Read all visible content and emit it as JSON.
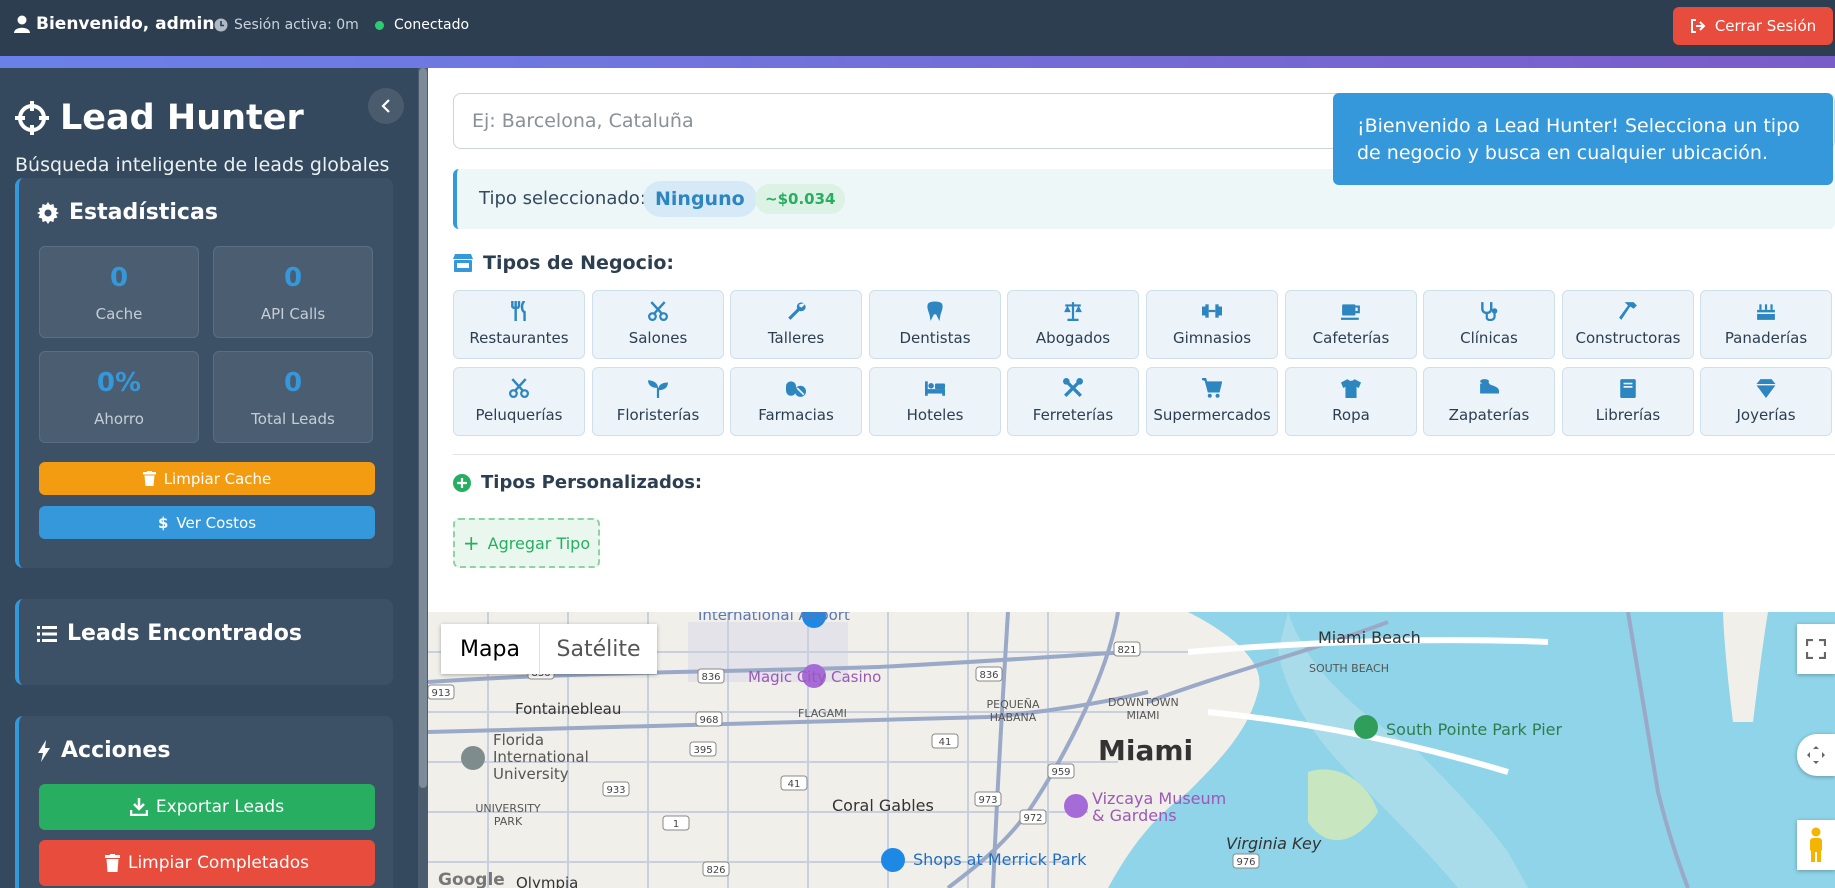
{
  "topbar": {
    "welcome": "Bienvenido, admin",
    "session": "Sesión activa: 0m",
    "status": "Conectado",
    "logout": "Cerrar Sesión"
  },
  "sidebar": {
    "brand": "Lead Hunter",
    "tagline": "Búsqueda inteligente de leads globales",
    "stats": {
      "title": "Estadísticas",
      "cache_value": "0",
      "cache_label": "Cache",
      "api_value": "0",
      "api_label": "API Calls",
      "saving_value": "0%",
      "saving_label": "Ahorro",
      "total_value": "0",
      "total_label": "Total Leads",
      "clear_cache": "Limpiar Cache",
      "view_costs": "Ver Costos"
    },
    "leads": {
      "title": "Leads Encontrados"
    },
    "actions": {
      "title": "Acciones",
      "export": "Exportar Leads",
      "clear_completed": "Limpiar Completados"
    }
  },
  "main": {
    "search_placeholder": "Ej: Barcelona, Cataluña",
    "tooltip": "¡Bienvenido a Lead Hunter! Selecciona un tipo de negocio y busca en cualquier ubicación.",
    "selected_label": "Tipo seleccionado:",
    "selected_value": "Ninguno",
    "selected_cost": "~$0.034",
    "business_title": "Tipos de Negocio:",
    "business_types": [
      {
        "label": "Restaurantes",
        "icon": "utensils-icon"
      },
      {
        "label": "Salones",
        "icon": "scissors-icon"
      },
      {
        "label": "Talleres",
        "icon": "wrench-icon"
      },
      {
        "label": "Dentistas",
        "icon": "tooth-icon"
      },
      {
        "label": "Abogados",
        "icon": "balance-scale-icon"
      },
      {
        "label": "Gimnasios",
        "icon": "dumbbell-icon"
      },
      {
        "label": "Cafeterías",
        "icon": "coffee-icon"
      },
      {
        "label": "Clínicas",
        "icon": "stethoscope-icon"
      },
      {
        "label": "Constructoras",
        "icon": "hammer-icon"
      },
      {
        "label": "Panaderías",
        "icon": "cake-icon"
      },
      {
        "label": "Peluquerías",
        "icon": "scissors-icon"
      },
      {
        "label": "Floristerías",
        "icon": "seedling-icon"
      },
      {
        "label": "Farmacias",
        "icon": "pills-icon"
      },
      {
        "label": "Hoteles",
        "icon": "bed-icon"
      },
      {
        "label": "Ferreterías",
        "icon": "tools-icon"
      },
      {
        "label": "Supermercados",
        "icon": "cart-icon"
      },
      {
        "label": "Ropa",
        "icon": "tshirt-icon"
      },
      {
        "label": "Zapaterías",
        "icon": "shoe-icon"
      },
      {
        "label": "Librerías",
        "icon": "book-icon"
      },
      {
        "label": "Joyerías",
        "icon": "gem-icon"
      }
    ],
    "custom_title": "Tipos Personalizados:",
    "add_type": "Agregar Tipo"
  },
  "map": {
    "tab_map": "Mapa",
    "tab_satellite": "Satélite",
    "labels": {
      "airport": "International Airport",
      "magic_city": "Magic City Casino",
      "fontainebleau": "Fontainebleau",
      "flagami": "FLAGAMI",
      "pequena": "PEQUEÑA HABANA",
      "downtown": "DOWNTOWN MIAMI",
      "miami": "Miami",
      "miami_beach": "Miami Beach",
      "south_beach": "SOUTH BEACH",
      "south_pointe": "South Pointe Park Pier",
      "fiu": "Florida International University",
      "university_park": "UNIVERSITY PARK",
      "coral_gables": "Coral Gables",
      "vizcaya": "Vizcaya Museum & Gardens",
      "virginia_key": "Virginia Key",
      "merrick": "Shops at Merrick Park",
      "olympia": "Olympia",
      "google": "Google"
    },
    "roads": [
      "836",
      "836",
      "968",
      "836",
      "395",
      "41",
      "41",
      "959",
      "933",
      "973",
      "972",
      "1",
      "826",
      "976",
      "913",
      "821"
    ],
    "colors": {
      "water": "#8fd4e8",
      "land": "#f1efe9",
      "road": "#9aa9c7"
    }
  },
  "colors": {
    "accent": "#3498db",
    "success": "#27ae60",
    "danger": "#e74c3c",
    "warning": "#f39c12",
    "sidebar": "#34495e",
    "topbar": "#2c3e50"
  }
}
